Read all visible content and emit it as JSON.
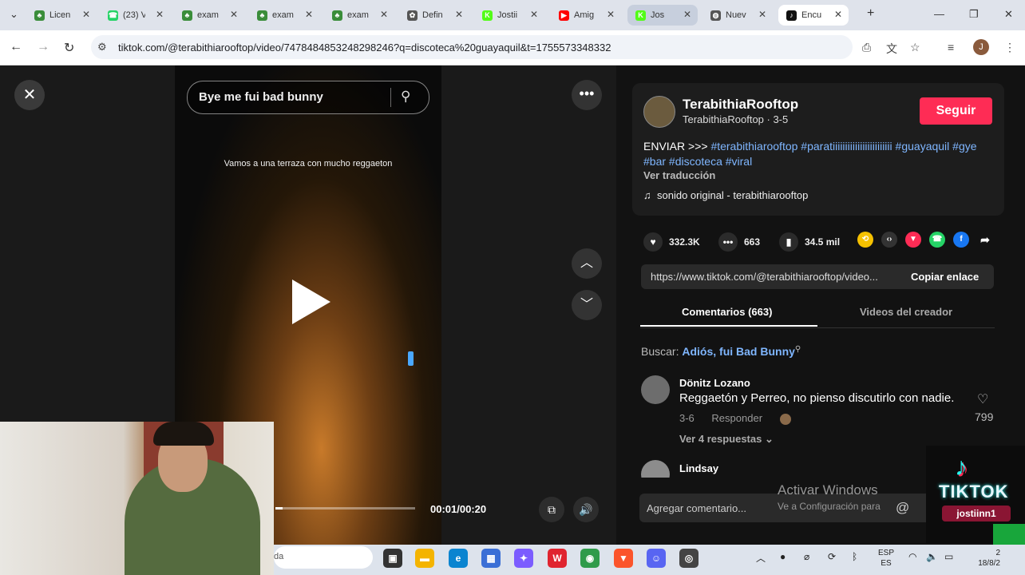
{
  "browser": {
    "tabs": [
      {
        "label": "Licen",
        "icon": "tree-favicon",
        "color": "#3a8d3a",
        "glyph": "♣"
      },
      {
        "label": "(23) V",
        "icon": "whatsapp-favicon",
        "color": "#25d366",
        "glyph": "☎"
      },
      {
        "label": "exam",
        "icon": "tree-favicon",
        "color": "#3a8d3a",
        "glyph": "♣"
      },
      {
        "label": "exam",
        "icon": "tree-favicon",
        "color": "#3a8d3a",
        "glyph": "♣"
      },
      {
        "label": "exam",
        "icon": "tree-favicon",
        "color": "#3a8d3a",
        "glyph": "♣"
      },
      {
        "label": "Defin",
        "icon": "openai-favicon",
        "color": "#555555",
        "glyph": "✿"
      },
      {
        "label": "Jostii",
        "icon": "kick-favicon",
        "color": "#53fc18",
        "glyph": "K"
      },
      {
        "label": "Amig",
        "icon": "youtube-favicon",
        "color": "#ff0000",
        "glyph": "▶"
      },
      {
        "label": "Jos",
        "icon": "kick-favicon",
        "color": "#53fc18",
        "glyph": "K"
      },
      {
        "label": "Nuev",
        "icon": "globe-favicon",
        "color": "#555555",
        "glyph": "◍"
      },
      {
        "label": "Encu",
        "icon": "tiktok-favicon",
        "color": "#111111",
        "glyph": "♪"
      }
    ],
    "url": "tiktok.com/@terabithiarooftop/video/7478484853248298246?q=discoteca%20guayaquil&t=1755573348332",
    "profile_initial": "J"
  },
  "video": {
    "search_query": "Bye me fui bad bunny",
    "caption": "Vamos a una terraza con mucho reggaeton",
    "timecode": "00:01/00:20",
    "progress": 0.05
  },
  "sidebar": {
    "channel_name": "TerabithiaRooftop",
    "channel_sub": "TerabithiaRooftop · 3-5",
    "follow_label": "Seguir",
    "desc_prefix": "ENVIAR >>> ",
    "hashtags": [
      "#terabithiarooftop",
      "#paratiiiiiiiiiiiiiiiiiiiiiiii",
      "#guayaquil",
      "#gye",
      "#bar",
      "#discoteca",
      "#viral"
    ],
    "translate": "Ver traducción",
    "music": "sonido original - terabithiarooftop",
    "likes": "332.3K",
    "comments": "663",
    "saves": "34.5 mil",
    "link": "https://www.tiktok.com/@terabithiarooftop/video...",
    "copy_label": "Copiar enlace",
    "tab_comments": "Comentarios (663)",
    "tab_creator": "Videos del creador",
    "buscar_label": "Buscar: ",
    "buscar_keyword": "Adiós, fui Bad Bunny",
    "comment1": {
      "user": "Dönitz Lozano",
      "text": "Reggaetón y Perreo, no pienso discutirlo con nadie.",
      "date": "3-6",
      "reply": "Responder",
      "likes": "799",
      "replies": "Ver 4 respuestas"
    },
    "comment2_user": "Lindsay",
    "comment_placeholder": "Agregar comentario...",
    "watermark1": "Activar Windows",
    "watermark2": "Ve a Configuración para"
  },
  "overlay": {
    "word": "TIKTOK",
    "handle": "jostiinn1",
    "accent_cyan": "#25f4ee",
    "accent_red": "#fe2c55"
  },
  "taskbar": {
    "search_placeholder": "da",
    "lang_top": "ESP",
    "lang_bottom": "ES",
    "clock_time": "2",
    "clock_date": "18/8/2"
  }
}
